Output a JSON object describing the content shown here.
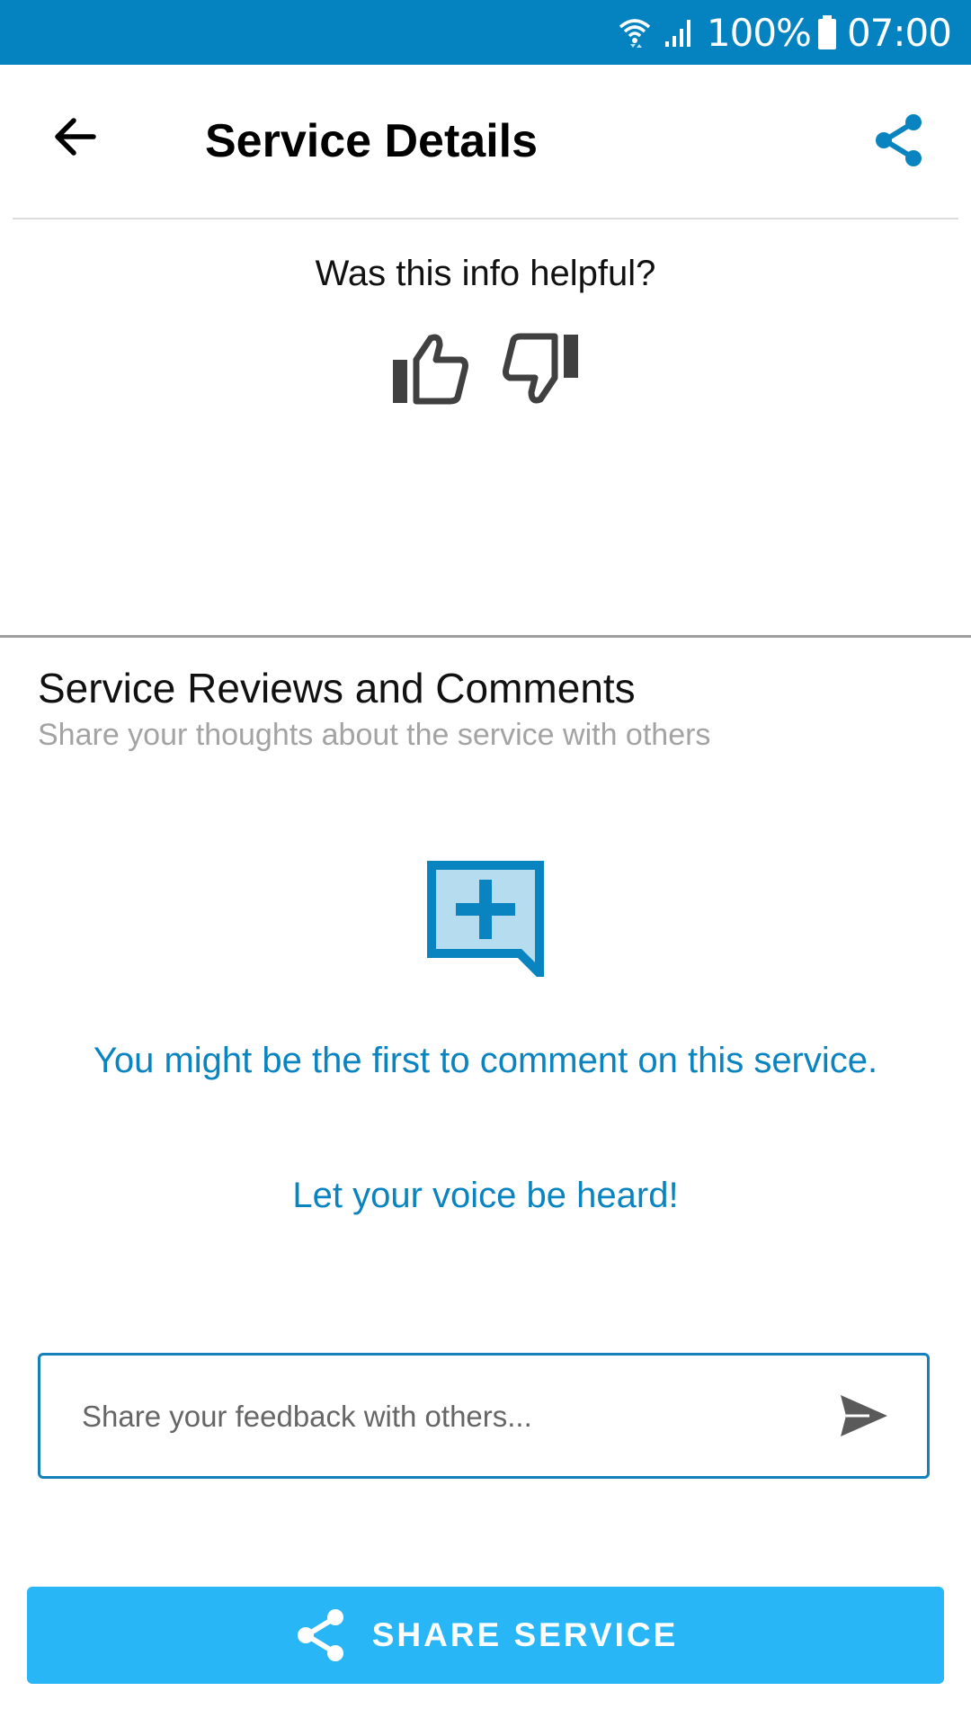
{
  "status_bar": {
    "battery": "100%",
    "time": "07:00",
    "color": "#0483c0"
  },
  "app_bar": {
    "title": "Service Details",
    "back_icon": "arrow-left-icon",
    "share_icon": "share-icon"
  },
  "helpful": {
    "question": "Was this info helpful?",
    "thumbs_up_icon": "thumbs-up-icon",
    "thumbs_down_icon": "thumbs-down-icon"
  },
  "reviews": {
    "title": "Service Reviews and Comments",
    "subtitle": "Share your thoughts about the service with others",
    "empty_icon": "add-comment-icon",
    "empty_line1": "You might be the first to comment on this service.",
    "empty_line2": "Let your voice be heard!"
  },
  "feedback": {
    "placeholder": "Share your feedback with others...",
    "value": "",
    "send_icon": "send-icon"
  },
  "share_button": {
    "label": "SHARE SERVICE",
    "color": "#29b6f6"
  },
  "colors": {
    "accent": "#0a84c0",
    "primary_dark": "#0483c0"
  }
}
